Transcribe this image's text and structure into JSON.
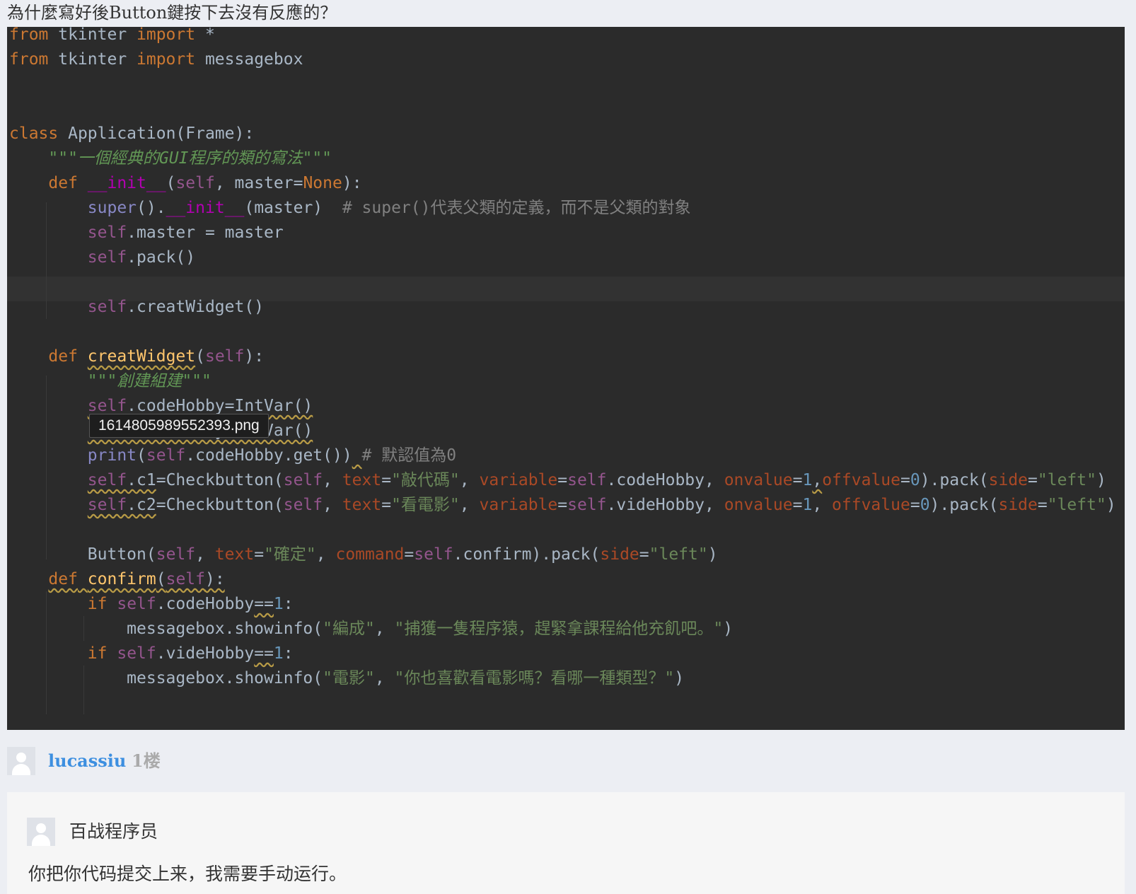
{
  "question": {
    "title": "為什麼寫好後Button鍵按下去沒有反應的？"
  },
  "code": {
    "lines": [
      [
        {
          "t": "from",
          "c": "kw"
        },
        {
          "t": " tkinter "
        },
        {
          "t": "import",
          "c": "kw"
        },
        {
          "t": " *"
        }
      ],
      [
        {
          "t": "from",
          "c": "kw"
        },
        {
          "t": " tkinter "
        },
        {
          "t": "import",
          "c": "kw"
        },
        {
          "t": " messagebox"
        }
      ],
      [],
      [],
      [
        {
          "t": "class",
          "c": "kw"
        },
        {
          "t": " Application(Frame):"
        }
      ],
      [
        {
          "t": "    "
        },
        {
          "t": "\"\"\"一個經典的GUI程序的類的寫法\"\"\"",
          "c": "doc"
        }
      ],
      [
        {
          "t": "    "
        },
        {
          "t": "def",
          "c": "kw"
        },
        {
          "t": " "
        },
        {
          "t": "__init__",
          "c": "magic"
        },
        {
          "t": "("
        },
        {
          "t": "self",
          "c": "slf"
        },
        {
          "t": ", master="
        },
        {
          "t": "None",
          "c": "kw"
        },
        {
          "t": "):"
        }
      ],
      [
        {
          "t": "        "
        },
        {
          "t": "super",
          "c": "bi"
        },
        {
          "t": "()."
        },
        {
          "t": "__init__",
          "c": "magic"
        },
        {
          "t": "(master)  "
        },
        {
          "t": "# super()代表父類的定義，而不是父類的對象",
          "c": "cmt"
        }
      ],
      [
        {
          "t": "        "
        },
        {
          "t": "self",
          "c": "slf"
        },
        {
          "t": ".master = master"
        }
      ],
      [
        {
          "t": "        "
        },
        {
          "t": "self",
          "c": "slf"
        },
        {
          "t": ".pack()"
        }
      ],
      [],
      [
        {
          "t": "        "
        },
        {
          "t": "self",
          "c": "slf"
        },
        {
          "t": ".creatWidget()"
        }
      ],
      [],
      [
        {
          "t": "    "
        },
        {
          "t": "def",
          "c": "kw"
        },
        {
          "t": " "
        },
        {
          "t": "creatWidget",
          "c": "fn sq"
        },
        {
          "t": "("
        },
        {
          "t": "self",
          "c": "slf"
        },
        {
          "t": "):"
        }
      ],
      [
        {
          "t": "        "
        },
        {
          "t": "\"\"\"創建組建\"\"\"",
          "c": "doc"
        }
      ],
      [
        {
          "t": "        "
        },
        {
          "t": "self",
          "c": "slf sq"
        },
        {
          "t": ".codeHobby=IntVar()",
          "c": "sq"
        }
      ],
      [
        {
          "t": "        "
        },
        {
          "t": "self",
          "c": "slf sq"
        },
        {
          "t": ".videHobby=IntVar()",
          "c": "sq"
        }
      ],
      [
        {
          "t": "        "
        },
        {
          "t": "print",
          "c": "bi"
        },
        {
          "t": "("
        },
        {
          "t": "self",
          "c": "slf"
        },
        {
          "t": ".codeHobby.get())"
        },
        {
          "t": " ",
          "c": "sq"
        },
        {
          "t": "# 默認值為0",
          "c": "cmt"
        }
      ],
      [
        {
          "t": "        "
        },
        {
          "t": "self",
          "c": "slf sq"
        },
        {
          "t": ".c1",
          "c": "sq"
        },
        {
          "t": "=Checkbutton("
        },
        {
          "t": "self",
          "c": "slf"
        },
        {
          "t": ", "
        },
        {
          "t": "text",
          "c": "prm"
        },
        {
          "t": "="
        },
        {
          "t": "\"敲代碼\"",
          "c": "str"
        },
        {
          "t": ", "
        },
        {
          "t": "variable",
          "c": "prm"
        },
        {
          "t": "="
        },
        {
          "t": "self",
          "c": "slf"
        },
        {
          "t": ".codeHobby, "
        },
        {
          "t": "onvalue",
          "c": "prm"
        },
        {
          "t": "="
        },
        {
          "t": "1",
          "c": "num"
        },
        {
          "t": ",",
          "c": "sq"
        },
        {
          "t": "offvalue",
          "c": "prm"
        },
        {
          "t": "="
        },
        {
          "t": "0",
          "c": "num"
        },
        {
          "t": ").pack("
        },
        {
          "t": "side",
          "c": "prm"
        },
        {
          "t": "="
        },
        {
          "t": "\"left\"",
          "c": "str"
        },
        {
          "t": ")"
        }
      ],
      [
        {
          "t": "        "
        },
        {
          "t": "self",
          "c": "slf sq"
        },
        {
          "t": ".c2",
          "c": "sq"
        },
        {
          "t": "=Checkbutton("
        },
        {
          "t": "self",
          "c": "slf"
        },
        {
          "t": ", "
        },
        {
          "t": "text",
          "c": "prm"
        },
        {
          "t": "="
        },
        {
          "t": "\"看電影\"",
          "c": "str"
        },
        {
          "t": ", "
        },
        {
          "t": "variable",
          "c": "prm"
        },
        {
          "t": "="
        },
        {
          "t": "self",
          "c": "slf"
        },
        {
          "t": ".videHobby, "
        },
        {
          "t": "onvalue",
          "c": "prm"
        },
        {
          "t": "="
        },
        {
          "t": "1",
          "c": "num"
        },
        {
          "t": ", "
        },
        {
          "t": "offvalue",
          "c": "prm"
        },
        {
          "t": "="
        },
        {
          "t": "0",
          "c": "num"
        },
        {
          "t": ").pack("
        },
        {
          "t": "side",
          "c": "prm"
        },
        {
          "t": "="
        },
        {
          "t": "\"left\"",
          "c": "str"
        },
        {
          "t": ")"
        }
      ],
      [],
      [
        {
          "t": "        Button("
        },
        {
          "t": "self",
          "c": "slf"
        },
        {
          "t": ", "
        },
        {
          "t": "text",
          "c": "prm"
        },
        {
          "t": "="
        },
        {
          "t": "\"確定\"",
          "c": "str"
        },
        {
          "t": ", "
        },
        {
          "t": "command",
          "c": "prm"
        },
        {
          "t": "="
        },
        {
          "t": "self",
          "c": "slf"
        },
        {
          "t": ".confirm).pack("
        },
        {
          "t": "side",
          "c": "prm"
        },
        {
          "t": "="
        },
        {
          "t": "\"left\"",
          "c": "str"
        },
        {
          "t": ")"
        }
      ],
      [
        {
          "t": "    "
        },
        {
          "t": "def",
          "c": "kw sq"
        },
        {
          "t": " ",
          "c": "sq"
        },
        {
          "t": "confirm",
          "c": "fn sq"
        },
        {
          "t": "(",
          "c": "sq"
        },
        {
          "t": "self",
          "c": "slf sq"
        },
        {
          "t": "):",
          "c": "sq"
        }
      ],
      [
        {
          "t": "        "
        },
        {
          "t": "if",
          "c": "kw"
        },
        {
          "t": " "
        },
        {
          "t": "self",
          "c": "slf"
        },
        {
          "t": ".codeHobby"
        },
        {
          "t": "==",
          "c": "sq"
        },
        {
          "t": "1",
          "c": "num"
        },
        {
          "t": ":"
        }
      ],
      [
        {
          "t": "            messagebox.showinfo("
        },
        {
          "t": "\"編成\"",
          "c": "str"
        },
        {
          "t": ", "
        },
        {
          "t": "\"捕獲一隻程序猿，趕緊拿課程給他充飢吧。\"",
          "c": "str"
        },
        {
          "t": ")"
        }
      ],
      [
        {
          "t": "        "
        },
        {
          "t": "if",
          "c": "kw"
        },
        {
          "t": " "
        },
        {
          "t": "self",
          "c": "slf"
        },
        {
          "t": ".videHobby"
        },
        {
          "t": "==",
          "c": "sq"
        },
        {
          "t": "1",
          "c": "num"
        },
        {
          "t": ":"
        }
      ],
      [
        {
          "t": "            messagebox.showinfo("
        },
        {
          "t": "\"電影\"",
          "c": "str"
        },
        {
          "t": ", "
        },
        {
          "t": "\"你也喜歡看電影嗎？看哪一種類型？\"",
          "c": "str"
        },
        {
          "t": ")"
        }
      ]
    ]
  },
  "tooltip": {
    "filename": "1614805989552393.png"
  },
  "reply": {
    "username": "lucassiu",
    "floor": "1楼"
  },
  "answer": {
    "author": "百战程序员",
    "text": "你把你代码提交上来，我需要手动运行。"
  }
}
